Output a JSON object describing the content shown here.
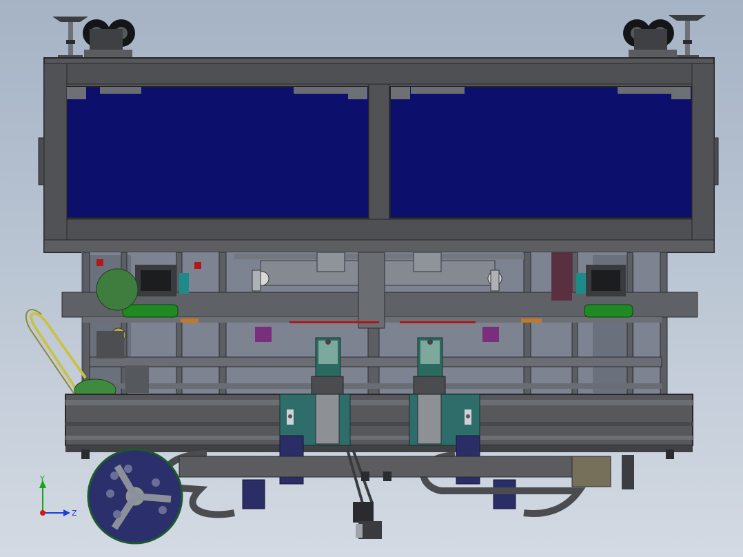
{
  "viewport": {
    "background_top": "#a5b3c5",
    "background_bottom": "#d3dae3"
  },
  "model": {
    "frame_color": "#4a4c50",
    "panel_color": "#0c0f6b",
    "rail_color": "#5a5c60",
    "mount_plate_color": "#2e6d6a",
    "motor_green": "#1f8a22",
    "handle_color": "#c9c24a",
    "bracket_navy": "#2a2d66"
  },
  "triad": {
    "y_label": "Y",
    "z_label": "Z",
    "y_color": "#1aa31a",
    "z_color": "#1a3fd6",
    "x_color": "#d01a1a"
  }
}
